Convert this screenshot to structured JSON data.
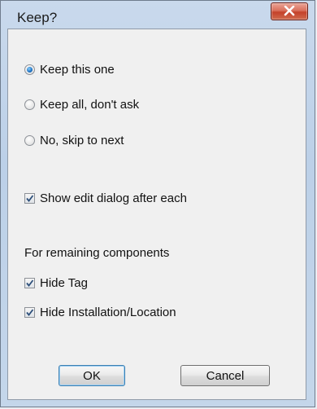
{
  "window": {
    "title": "Keep?"
  },
  "options": [
    {
      "label": "Keep this one",
      "checked": true
    },
    {
      "label": "Keep all, don't ask",
      "checked": false
    },
    {
      "label": "No, skip to next",
      "checked": false
    }
  ],
  "show_edit": {
    "label": "Show edit dialog after each",
    "checked": true
  },
  "remaining": {
    "heading": "For remaining components",
    "items": [
      {
        "label": "Hide Tag",
        "checked": true
      },
      {
        "label": "Hide Installation/Location",
        "checked": true
      }
    ]
  },
  "buttons": {
    "ok": "OK",
    "cancel": "Cancel"
  },
  "icons": {
    "close": "close-icon"
  }
}
